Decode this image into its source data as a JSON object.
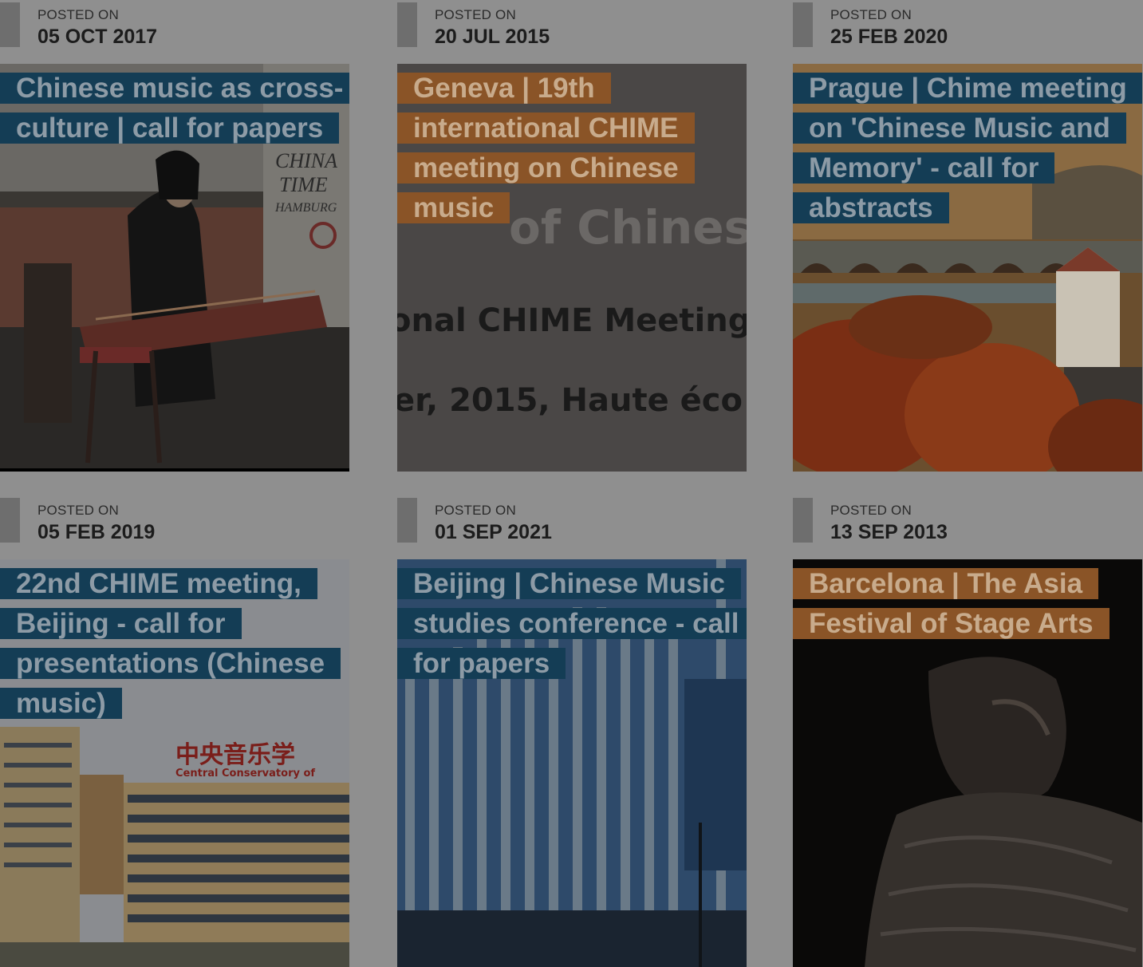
{
  "posted_label": "POSTED ON",
  "posts": [
    {
      "date": "05 OCT 2017",
      "title": "Chinese music as cross-culture | call for papers",
      "tag_color": "blue",
      "image_overlay_text": [
        "CHINA",
        "TIME",
        "HAMBURG"
      ]
    },
    {
      "date": "20 JUL 2015",
      "title": "Geneva | 19th international CHIME meeting on Chinese music",
      "tag_color": "orange",
      "image_overlay_text": [
        "of Chines",
        "onal CHIME Meeting",
        "er, 2015, Haute éco"
      ]
    },
    {
      "date": "25 FEB 2020",
      "title": "Prague | Chime meeting on 'Chinese Music and Memory' - call for abstracts",
      "tag_color": "blue"
    },
    {
      "date": "05 FEB 2019",
      "title": "22nd CHIME meeting, Beijing - call for presentations (Chinese music)",
      "tag_color": "blue",
      "image_overlay_text": [
        "中央音乐学",
        "Central Conservatory of"
      ]
    },
    {
      "date": "01 SEP 2021",
      "title": "Beijing | Chinese Music studies conference - call for papers",
      "tag_color": "blue"
    },
    {
      "date": "13 SEP 2013",
      "title": "Barcelona | The Asia Festival of Stage Arts",
      "tag_color": "orange"
    }
  ]
}
